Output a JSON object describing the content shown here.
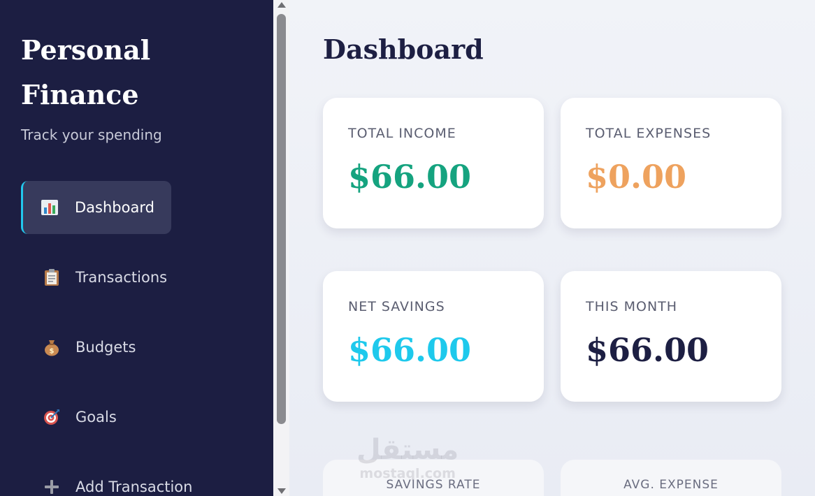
{
  "sidebar": {
    "brand": "Personal Finance",
    "tagline": "Track your spending",
    "items": [
      {
        "label": "Dashboard",
        "icon": "bar-chart-icon",
        "active": true
      },
      {
        "label": "Transactions",
        "icon": "clipboard-icon",
        "active": false
      },
      {
        "label": "Budgets",
        "icon": "money-bag-icon",
        "active": false
      },
      {
        "label": "Goals",
        "icon": "target-icon",
        "active": false
      },
      {
        "label": "Add Transaction",
        "icon": "plus-icon",
        "active": false
      }
    ]
  },
  "main": {
    "title": "Dashboard",
    "cards": [
      {
        "label": "TOTAL INCOME",
        "value": "$66.00",
        "color": "#15a37f"
      },
      {
        "label": "TOTAL EXPENSES",
        "value": "$0.00",
        "color": "#eea25e"
      },
      {
        "label": "NET SAVINGS",
        "value": "$66.00",
        "color": "#1ec9ec"
      },
      {
        "label": "THIS MONTH",
        "value": "$66.00",
        "color": "#1d1f43"
      },
      {
        "label": "SAVINGS RATE"
      },
      {
        "label": "AVG. EXPENSE"
      }
    ]
  },
  "watermark": {
    "arabic": "مستقل",
    "latin": "mostaql.com"
  },
  "colors": {
    "sidebar_bg": "#1c1e42",
    "accent": "#22c8ee",
    "active_item_bg": "#373a5c"
  }
}
